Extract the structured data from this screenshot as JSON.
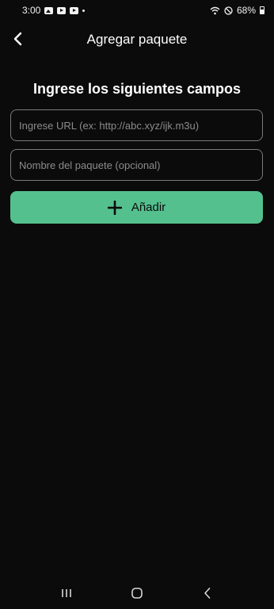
{
  "status_bar": {
    "time": "3:00",
    "battery": "68%",
    "icons": [
      "gallery-icon",
      "youtube-icon",
      "youtube-icon",
      "dot-icon",
      "wifi-icon",
      "do-not-disturb-icon",
      "battery-icon"
    ]
  },
  "app_bar": {
    "back_icon": "chevron-left-icon",
    "title": "Agregar paquete"
  },
  "form": {
    "heading": "Ingrese los siguientes campos",
    "url_placeholder": "Ingrese URL (ex: http://abc.xyz/ijk.m3u)",
    "url_value": "",
    "name_placeholder": "Nombre del paquete (opcional)",
    "name_value": "",
    "add_label": "Añadir",
    "add_icon": "plus-icon"
  },
  "nav_bar": {
    "items": [
      "recents-icon",
      "home-icon",
      "back-icon"
    ]
  },
  "colors": {
    "background": "#0b0b0b",
    "accent": "#54c08e",
    "field_border": "#7a7a7a"
  }
}
